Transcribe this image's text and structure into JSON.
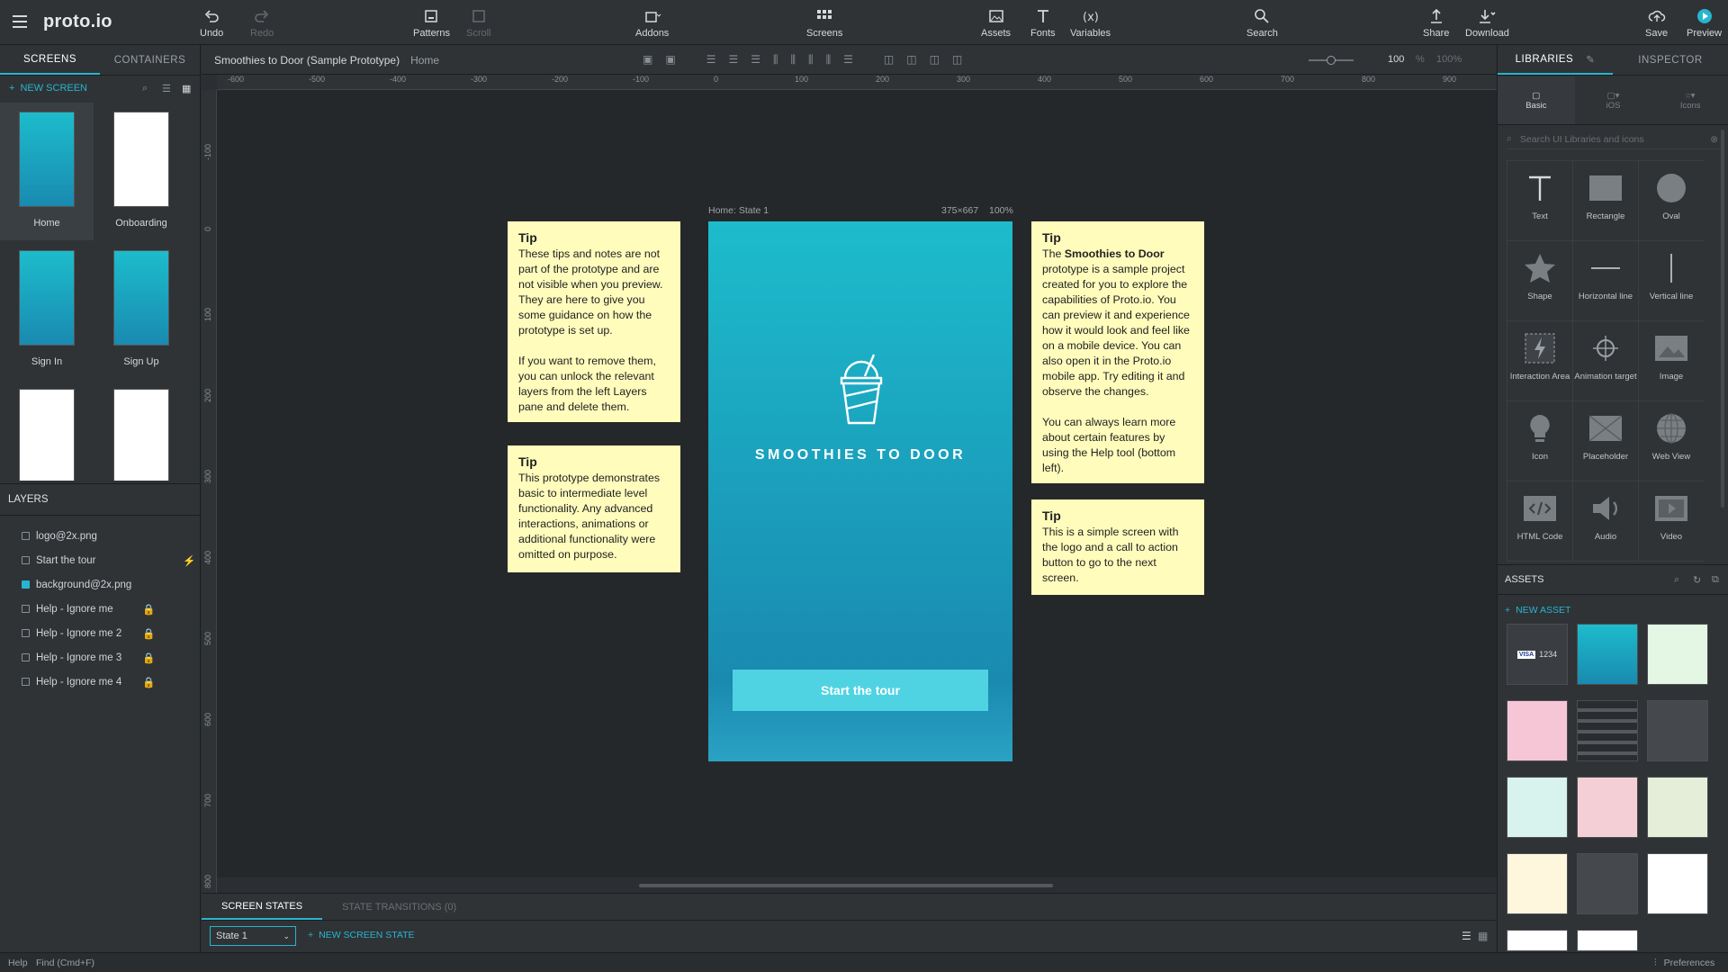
{
  "app": {
    "logo": "proto.io"
  },
  "toolbar": {
    "undo": "Undo",
    "redo": "Redo",
    "patterns": "Patterns",
    "scroll": "Scroll",
    "addons": "Addons",
    "screens": "Screens",
    "assets": "Assets",
    "fonts": "Fonts",
    "variables": "Variables",
    "search": "Search",
    "share": "Share",
    "download": "Download",
    "save": "Save",
    "preview": "Preview"
  },
  "left": {
    "tab_screens": "SCREENS",
    "tab_containers": "CONTAINERS",
    "new_screen": "NEW SCREEN",
    "screens": [
      {
        "label": "Home"
      },
      {
        "label": "Onboarding"
      },
      {
        "label": "Sign In"
      },
      {
        "label": "Sign Up"
      },
      {
        "label": ""
      },
      {
        "label": ""
      }
    ],
    "layers_title": "LAYERS",
    "layers": [
      {
        "label": "logo@2x.png"
      },
      {
        "label": "Start the tour"
      },
      {
        "label": "background@2x.png"
      },
      {
        "label": "Help - Ignore me"
      },
      {
        "label": "Help - Ignore me 2"
      },
      {
        "label": "Help - Ignore me 3"
      },
      {
        "label": "Help - Ignore me 4"
      }
    ]
  },
  "breadcrumb": {
    "project": "Smoothies to Door (Sample Prototype)",
    "screen": "Home"
  },
  "zoom": {
    "value": "100",
    "unit": "%",
    "fit": "100%"
  },
  "ruler": {
    "h": [
      "-600",
      "-500",
      "-400",
      "-300",
      "-200",
      "-100",
      "0",
      "100",
      "200",
      "300",
      "400",
      "500",
      "600",
      "700",
      "800",
      "900"
    ],
    "v": [
      "-100",
      "0",
      "100",
      "200",
      "300",
      "400",
      "500",
      "600",
      "700",
      "800"
    ]
  },
  "phone": {
    "state_label": "Home: State 1",
    "size": "375×667",
    "zoom": "100%",
    "title": "SMOOTHIES TO DOOR",
    "cta": "Start the tour"
  },
  "notes": [
    {
      "title": "Tip",
      "body": "These tips and notes are not part of the prototype and are not visible when you preview. They are here to give you some guidance on how the prototype is set up.",
      "body2": "If you want to remove them, you can unlock the relevant layers from the left Layers pane and delete them."
    },
    {
      "title": "Tip",
      "body": "This prototype demonstrates basic to intermediate level functionality. Any advanced interactions, animations or additional functionality were omitted on purpose."
    },
    {
      "title": "Tip",
      "pre": "The ",
      "bold": "Smoothies to Door",
      "body": " prototype is a sample project created for you to explore the capabilities of Proto.io. You can preview it and experience how it would look and feel like on a mobile device. You can also open it in the Proto.io mobile app. Try editing it and observe the changes.",
      "body2": "You can always learn more about certain features by using the Help tool (bottom left)."
    },
    {
      "title": "Tip",
      "body": "This is a simple screen with the logo and a call to action button to go to the next screen."
    }
  ],
  "right": {
    "tab_libraries": "LIBRARIES",
    "tab_inspector": "INSPECTOR",
    "lib_tabs": [
      "Basic",
      "iOS",
      "Icons"
    ],
    "search_placeholder": "Search UI Libraries and icons",
    "items": [
      "Text",
      "Rectangle",
      "Oval",
      "Shape",
      "Horizontal line",
      "Vertical line",
      "Interaction Area",
      "Animation target",
      "Image",
      "Icon",
      "Placeholder",
      "Web View",
      "HTML Code",
      "Audio",
      "Video"
    ],
    "assets_title": "ASSETS",
    "new_asset": "NEW ASSET",
    "card_text": "1234"
  },
  "states": {
    "tab_states": "SCREEN STATES",
    "tab_transitions": "STATE TRANSITIONS (0)",
    "selected": "State 1",
    "new_state": "NEW SCREEN STATE"
  },
  "status": {
    "help": "Help",
    "find": "Find (Cmd+F)",
    "preferences": "Preferences"
  },
  "colors": {
    "accent": "#27b5d0",
    "note": "#fffcbc"
  }
}
